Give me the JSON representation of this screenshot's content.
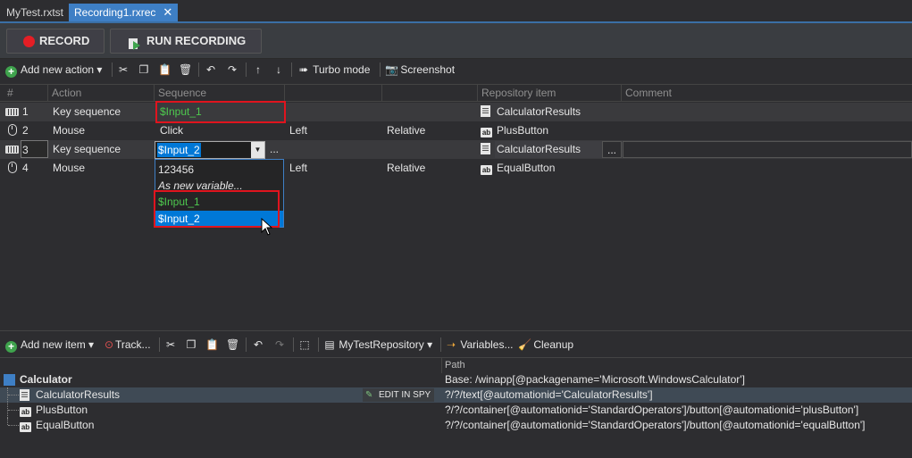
{
  "tabs": [
    {
      "label": "MyTest.rxtst"
    },
    {
      "label": "Recording1.rxrec"
    }
  ],
  "recording_toolbar": {
    "record_label": "RECORD",
    "run_label": "RUN RECORDING"
  },
  "action_toolbar": {
    "add_new_action": "Add new action",
    "turbo_mode": "Turbo mode",
    "screenshot": "Screenshot"
  },
  "grid": {
    "headers": [
      "#",
      "Action",
      "Sequence",
      "",
      "",
      "Repository item",
      "Comment"
    ],
    "rows": [
      {
        "num": "1",
        "action": "Key sequence",
        "seq": "$Input_1",
        "c3": "",
        "c4": "",
        "repo": "CalculatorResults",
        "icon": "keyboard-icon"
      },
      {
        "num": "2",
        "action": "Mouse",
        "seq": "Click",
        "c3": "Left",
        "c4": "Relative",
        "repo": "PlusButton",
        "icon": "mouse-icon"
      },
      {
        "num": "3",
        "action": "Key sequence",
        "seq": "$Input_2",
        "c3": "...",
        "c4": "",
        "repo": "CalculatorResults",
        "repo_more": "...",
        "icon": "keyboard-icon"
      },
      {
        "num": "4",
        "action": "Mouse",
        "seq": "",
        "c3": "Left",
        "c4": "Relative",
        "repo": "EqualButton",
        "icon": "mouse-icon"
      }
    ]
  },
  "dropdown": {
    "options": [
      "123456",
      "As new variable...",
      "$Input_1",
      "$Input_2"
    ],
    "selected": "$Input_2"
  },
  "repo_toolbar": {
    "add_new_item": "Add new item",
    "track": "Track...",
    "repository": "MyTestRepository",
    "variables": "Variables...",
    "cleanup": "Cleanup"
  },
  "repo": {
    "path_header": "Path",
    "root": {
      "name": "Calculator",
      "path": "Base: /winapp[@packagename='Microsoft.WindowsCalculator']"
    },
    "items": [
      {
        "name": "CalculatorResults",
        "path": "?/?/text[@automationid='CalculatorResults']",
        "action": "EDIT IN SPY"
      },
      {
        "name": "PlusButton",
        "path": "?/?/container[@automationid='StandardOperators']/button[@automationid='plusButton']"
      },
      {
        "name": "EqualButton",
        "path": "?/?/container[@automationid='StandardOperators']/button[@automationid='equalButton']"
      }
    ]
  },
  "colors": {
    "accent": "#3e7fc5",
    "highlight": "#e0141e",
    "variable": "#4ec94e"
  }
}
